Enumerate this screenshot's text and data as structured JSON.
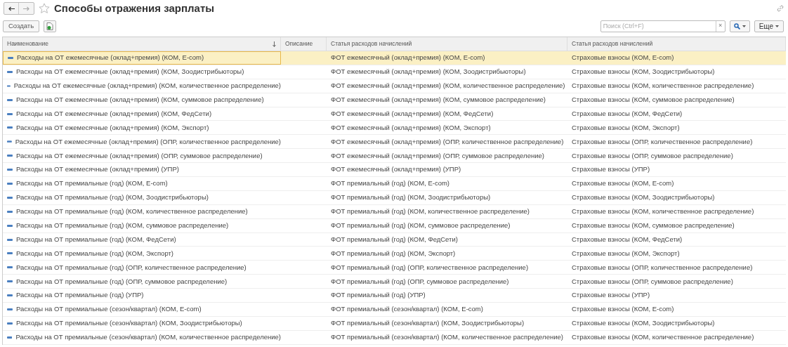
{
  "window": {
    "title": "Способы отражения зарплаты"
  },
  "toolbar": {
    "create_button": "Создать",
    "search": {
      "placeholder": "Поиск (Ctrl+F)"
    },
    "clear_button": "×",
    "more_button": "Еще"
  },
  "table": {
    "columns": [
      "Наименование",
      "Описание",
      "Статья расходов начислений",
      "Статья расходов начислений"
    ],
    "rows": [
      {
        "name": "Расходы на ОТ ежемесячные (оклад+премия) (КОМ, E-com)",
        "article": "ФОТ ежемесячный (оклад+премия) (КОМ, E-com)",
        "insurance": "Страховые взносы (КОМ, E-com)",
        "selected": true
      },
      {
        "name": "Расходы на ОТ ежемесячные (оклад+премия) (КОМ, Зоодистрибьюторы)",
        "article": "ФОТ ежемесячный (оклад+премия) (КОМ, Зоодистрибьюторы)",
        "insurance": "Страховые взносы (КОМ, Зоодистрибьюторы)",
        "selected": false
      },
      {
        "name": "Расходы на ОТ ежемесячные (оклад+премия) (КОМ, количественное распределение)",
        "article": "ФОТ ежемесячный (оклад+премия) (КОМ, количественное распределение)",
        "insurance": "Страховые взносы (КОМ, количественное распределение)",
        "selected": false
      },
      {
        "name": "Расходы на ОТ ежемесячные (оклад+премия) (КОМ, суммовое распределение)",
        "article": "ФОТ ежемесячный (оклад+премия) (КОМ, суммовое распределение)",
        "insurance": "Страховые взносы (КОМ, суммовое распределение)",
        "selected": false
      },
      {
        "name": "Расходы на ОТ ежемесячные (оклад+премия) (КОМ, ФедСети)",
        "article": "ФОТ ежемесячный (оклад+премия) (КОМ, ФедСети)",
        "insurance": "Страховые взносы (КОМ, ФедСети)",
        "selected": false
      },
      {
        "name": "Расходы на ОТ ежемесячные (оклад+премия) (КОМ, Экспорт)",
        "article": "ФОТ ежемесячный (оклад+премия) (КОМ, Экспорт)",
        "insurance": "Страховые взносы (КОМ, Экспорт)",
        "selected": false
      },
      {
        "name": "Расходы на ОТ ежемесячные (оклад+премия) (ОПР, количественное распределение)",
        "article": "ФОТ ежемесячный (оклад+премия) (ОПР, количественное распределение)",
        "insurance": "Страховые взносы (ОПР, количественное распределение)",
        "selected": false
      },
      {
        "name": "Расходы на ОТ ежемесячные (оклад+премия) (ОПР, суммовое распределение)",
        "article": "ФОТ ежемесячный (оклад+премия) (ОПР, суммовое распределение)",
        "insurance": "Страховые взносы (ОПР, суммовое распределение)",
        "selected": false
      },
      {
        "name": "Расходы на ОТ ежемесячные (оклад+премия) (УПР)",
        "article": "ФОТ ежемесячный (оклад+премия) (УПР)",
        "insurance": "Страховые взносы (УПР)",
        "selected": false
      },
      {
        "name": "Расходы на ОТ премиальные (год) (КОМ, E-com)",
        "article": "ФОТ премиальный (год) (КОМ, E-com)",
        "insurance": "Страховые взносы (КОМ, E-com)",
        "selected": false
      },
      {
        "name": "Расходы на ОТ премиальные (год) (КОМ, Зоодистрибьюторы)",
        "article": "ФОТ премиальный (год) (КОМ, Зоодистрибьюторы)",
        "insurance": "Страховые взносы (КОМ, Зоодистрибьюторы)",
        "selected": false
      },
      {
        "name": "Расходы на ОТ премиальные (год) (КОМ, количественное распределение)",
        "article": "ФОТ премиальный (год) (КОМ, количественное распределение)",
        "insurance": "Страховые взносы (КОМ, количественное распределение)",
        "selected": false
      },
      {
        "name": "Расходы на ОТ премиальные (год) (КОМ, суммовое распределение)",
        "article": "ФОТ премиальный (год) (КОМ, суммовое распределение)",
        "insurance": "Страховые взносы (КОМ, суммовое распределение)",
        "selected": false
      },
      {
        "name": "Расходы на ОТ премиальные (год) (КОМ, ФедСети)",
        "article": "ФОТ премиальный (год) (КОМ, ФедСети)",
        "insurance": "Страховые взносы (КОМ, ФедСети)",
        "selected": false
      },
      {
        "name": "Расходы на ОТ премиальные (год) (КОМ, Экспорт)",
        "article": "ФОТ премиальный (год) (КОМ, Экспорт)",
        "insurance": "Страховые взносы (КОМ, Экспорт)",
        "selected": false
      },
      {
        "name": "Расходы на ОТ премиальные (год) (ОПР, количественное распределение)",
        "article": "ФОТ премиальный (год) (ОПР, количественное распределение)",
        "insurance": "Страховые взносы (ОПР, количественное распределение)",
        "selected": false
      },
      {
        "name": "Расходы на ОТ премиальные (год) (ОПР, суммовое распределение)",
        "article": "ФОТ премиальный (год) (ОПР, суммовое распределение)",
        "insurance": "Страховые взносы (ОПР, суммовое распределение)",
        "selected": false
      },
      {
        "name": "Расходы на ОТ премиальные (год) (УПР)",
        "article": "ФОТ премиальный (год) (УПР)",
        "insurance": "Страховые взносы (УПР)",
        "selected": false
      },
      {
        "name": "Расходы на ОТ премиальные (сезон/квартал) (КОМ, E-com)",
        "article": "ФОТ премиальный (сезон/квартал) (КОМ, E-com)",
        "insurance": "Страховые взносы (КОМ, E-com)",
        "selected": false
      },
      {
        "name": "Расходы на ОТ премиальные (сезон/квартал) (КОМ, Зоодистрибьюторы)",
        "article": "ФОТ премиальный (сезон/квартал) (КОМ, Зоодистрибьюторы)",
        "insurance": "Страховые взносы (КОМ, Зоодистрибьюторы)",
        "selected": false
      },
      {
        "name": "Расходы на ОТ премиальные (сезон/квартал) (КОМ, количественное распределение)",
        "article": "ФОТ премиальный (сезон/квартал) (КОМ, количественное распределение)",
        "insurance": "Страховые взносы (КОМ, количественное распределение)",
        "selected": false
      }
    ]
  }
}
